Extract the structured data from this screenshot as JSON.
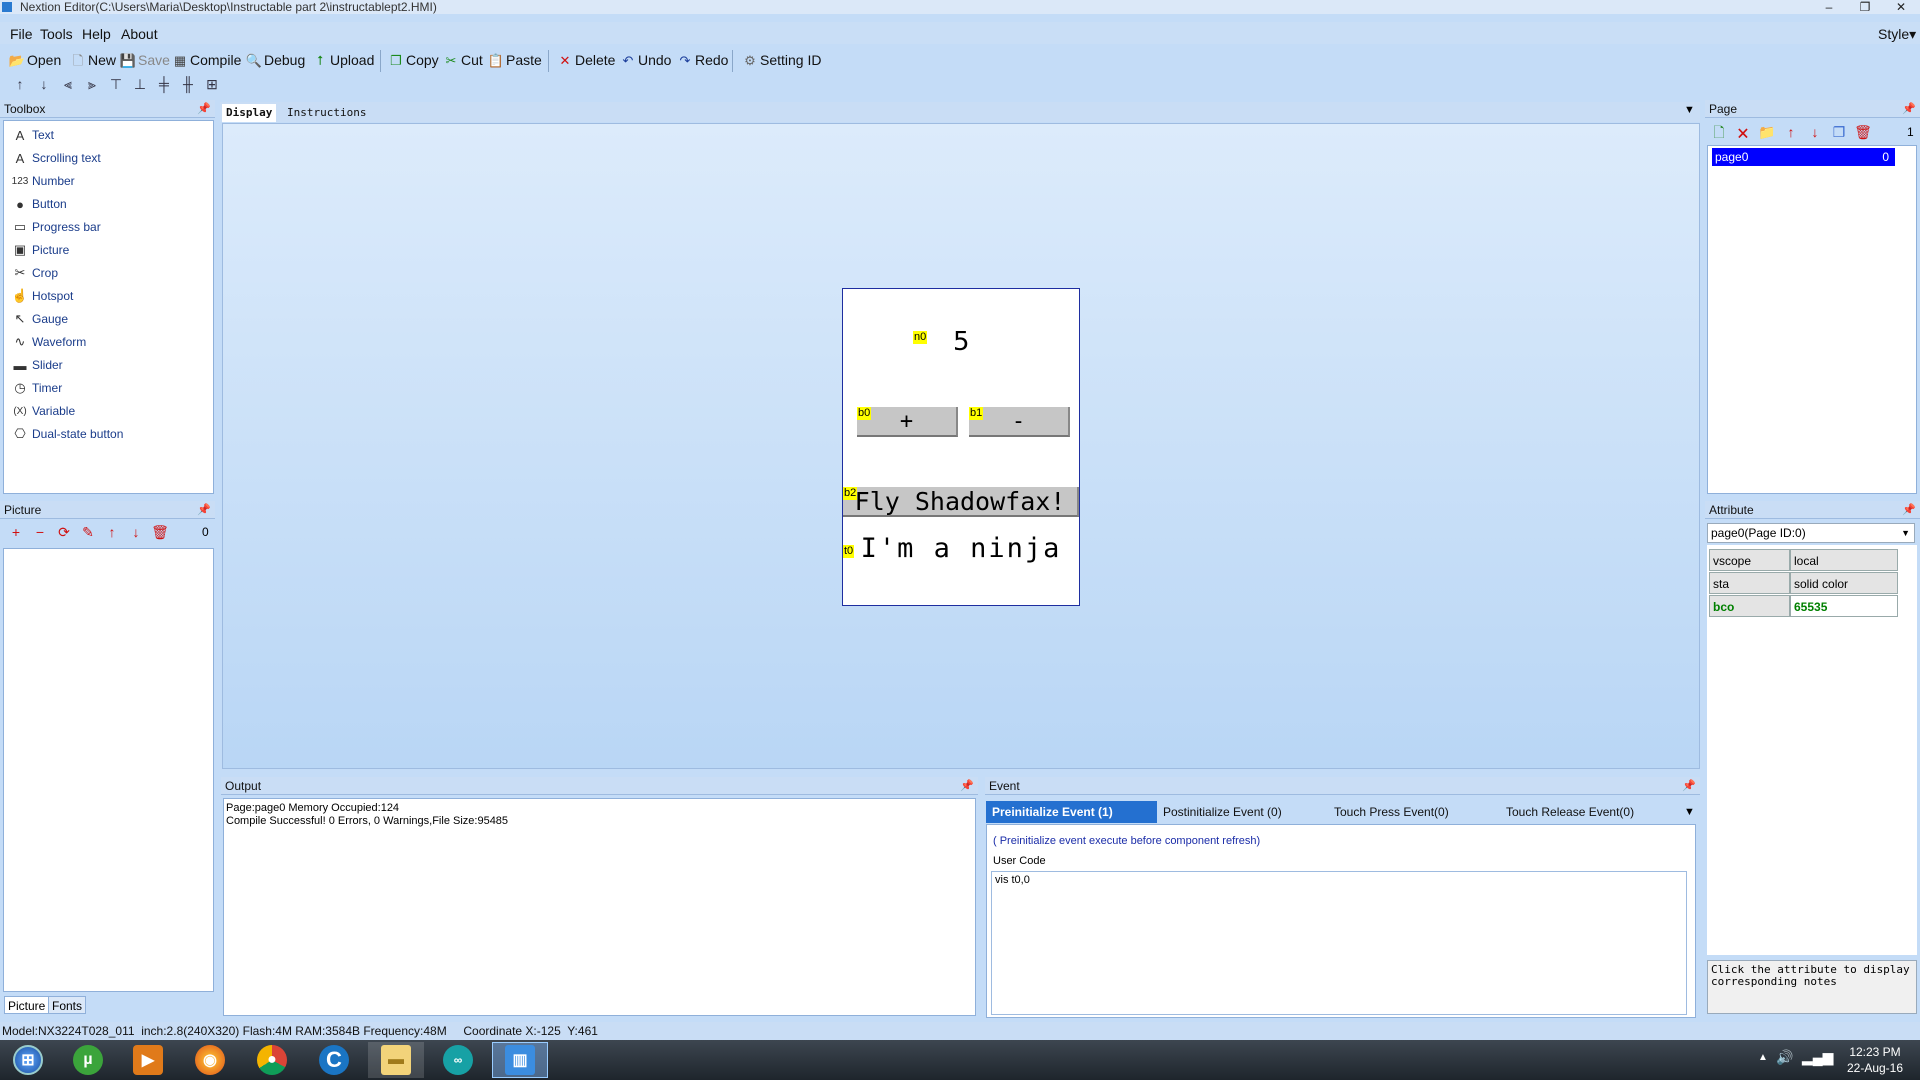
{
  "window": {
    "title": "Nextion Editor(C:\\Users\\Maria\\Desktop\\Instructable part 2\\instructablept2.HMI)",
    "min": "–",
    "max": "❐",
    "close": "✕"
  },
  "menu": {
    "file": "File",
    "tools": "Tools",
    "help": "Help",
    "about": "About",
    "style": "Style▾"
  },
  "toolbar": {
    "open": "Open",
    "new": "New",
    "save": "Save",
    "compile": "Compile",
    "debug": "Debug",
    "upload": "Upload",
    "copy": "Copy",
    "cut": "Cut",
    "paste": "Paste",
    "delete": "Delete",
    "undo": "Undo",
    "redo": "Redo",
    "setting_id": "Setting ID"
  },
  "toolbox": {
    "title": "Toolbox",
    "items": [
      {
        "label": "Text",
        "icon": "A"
      },
      {
        "label": "Scrolling text",
        "icon": "A"
      },
      {
        "label": "Number",
        "icon": "123"
      },
      {
        "label": "Button",
        "icon": "●"
      },
      {
        "label": "Progress bar",
        "icon": "▭"
      },
      {
        "label": "Picture",
        "icon": "▣"
      },
      {
        "label": "Crop",
        "icon": "✂"
      },
      {
        "label": "Hotspot",
        "icon": "☝"
      },
      {
        "label": "Gauge",
        "icon": "↖"
      },
      {
        "label": "Waveform",
        "icon": "∿"
      },
      {
        "label": "Slider",
        "icon": "▬"
      },
      {
        "label": "Timer",
        "icon": "◷"
      },
      {
        "label": "Variable",
        "icon": "(X)"
      },
      {
        "label": "Dual-state button",
        "icon": "⎔"
      }
    ]
  },
  "picture_panel": {
    "title": "Picture",
    "count": "0",
    "tab_picture": "Picture",
    "tab_fonts": "Fonts"
  },
  "tabs": {
    "display": "Display",
    "instructions": "Instructions"
  },
  "hmi": {
    "n0_tag": "n0",
    "n0_value": "5",
    "b0_tag": "b0",
    "b0_label": "+",
    "b1_tag": "b1",
    "b1_label": "-",
    "b2_tag": "b2",
    "b2_label": "Fly Shadowfax!",
    "t0_tag": "t0",
    "t0_label": "I'm a ninja"
  },
  "page_panel": {
    "title": "Page",
    "count": "1",
    "page_name": "page0",
    "page_id": "0"
  },
  "attribute_panel": {
    "title": "Attribute",
    "selector": "page0(Page ID:0)",
    "rows": [
      {
        "name": "vscope",
        "value": "local"
      },
      {
        "name": "sta",
        "value": "solid color"
      },
      {
        "name": "bco",
        "value": "65535"
      }
    ],
    "note": "Click the attribute to display corresponding notes"
  },
  "output": {
    "title": "Output",
    "lines": [
      "Page:page0 Memory Occupied:124",
      "Compile Successful! 0 Errors, 0 Warnings,File Size:95485"
    ]
  },
  "event": {
    "title": "Event",
    "tabs": [
      "Preinitialize Event (1)",
      "Postinitialize Event (0)",
      "Touch Press Event(0)",
      "Touch Release Event(0)"
    ],
    "description": "( Preinitialize event execute before component refresh)",
    "user_code_label": "User Code",
    "code": "vis t0,0"
  },
  "status": {
    "text": "Model:NX3224T028_011  inch:2.8(240X320) Flash:4M RAM:3584B Frequency:48M     Coordinate X:-125  Y:461"
  },
  "taskbar": {
    "time": "12:23 PM",
    "date": "22-Aug-16"
  },
  "colors": {
    "accent": "#1a57c8",
    "selection": "#0000ff",
    "hmi_tag": "#ffff00",
    "bco_green": "#008000"
  }
}
